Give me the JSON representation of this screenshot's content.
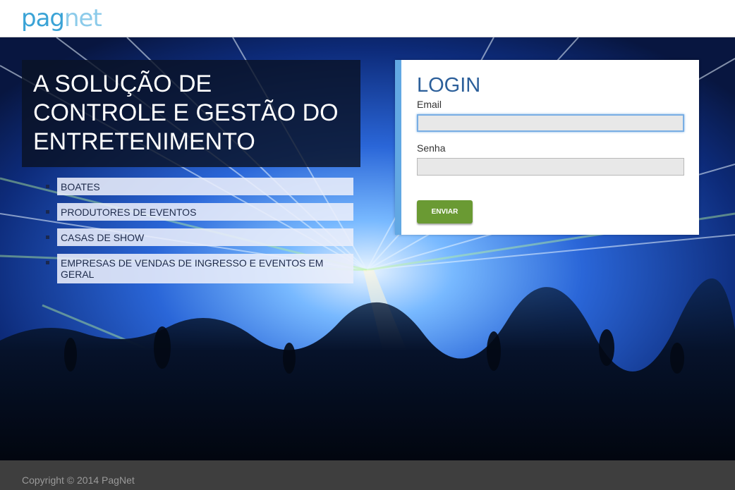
{
  "header": {
    "logo_text_pag": "pag",
    "logo_text_net": "net"
  },
  "hero": {
    "headline": "A SOLUÇÃO DE CONTROLE E GESTÃO DO ENTRETENIMENTO",
    "features": [
      "BOATES",
      "PRODUTORES DE EVENTOS",
      "CASAS DE SHOW",
      "EMPRESAS DE VENDAS DE INGRESSO E EVENTOS EM GERAL"
    ]
  },
  "login": {
    "title": "LOGIN",
    "email_label": "Email",
    "email_value": "",
    "password_label": "Senha",
    "password_value": "",
    "submit_label": "ENVIAR"
  },
  "footer": {
    "copyright": "Copyright © 2014 PagNet"
  },
  "colors": {
    "brand_blue": "#3aa3d6",
    "login_accent": "#62a8e3",
    "submit_green": "#6a9a33",
    "footer_bg": "#3e3e3e"
  }
}
